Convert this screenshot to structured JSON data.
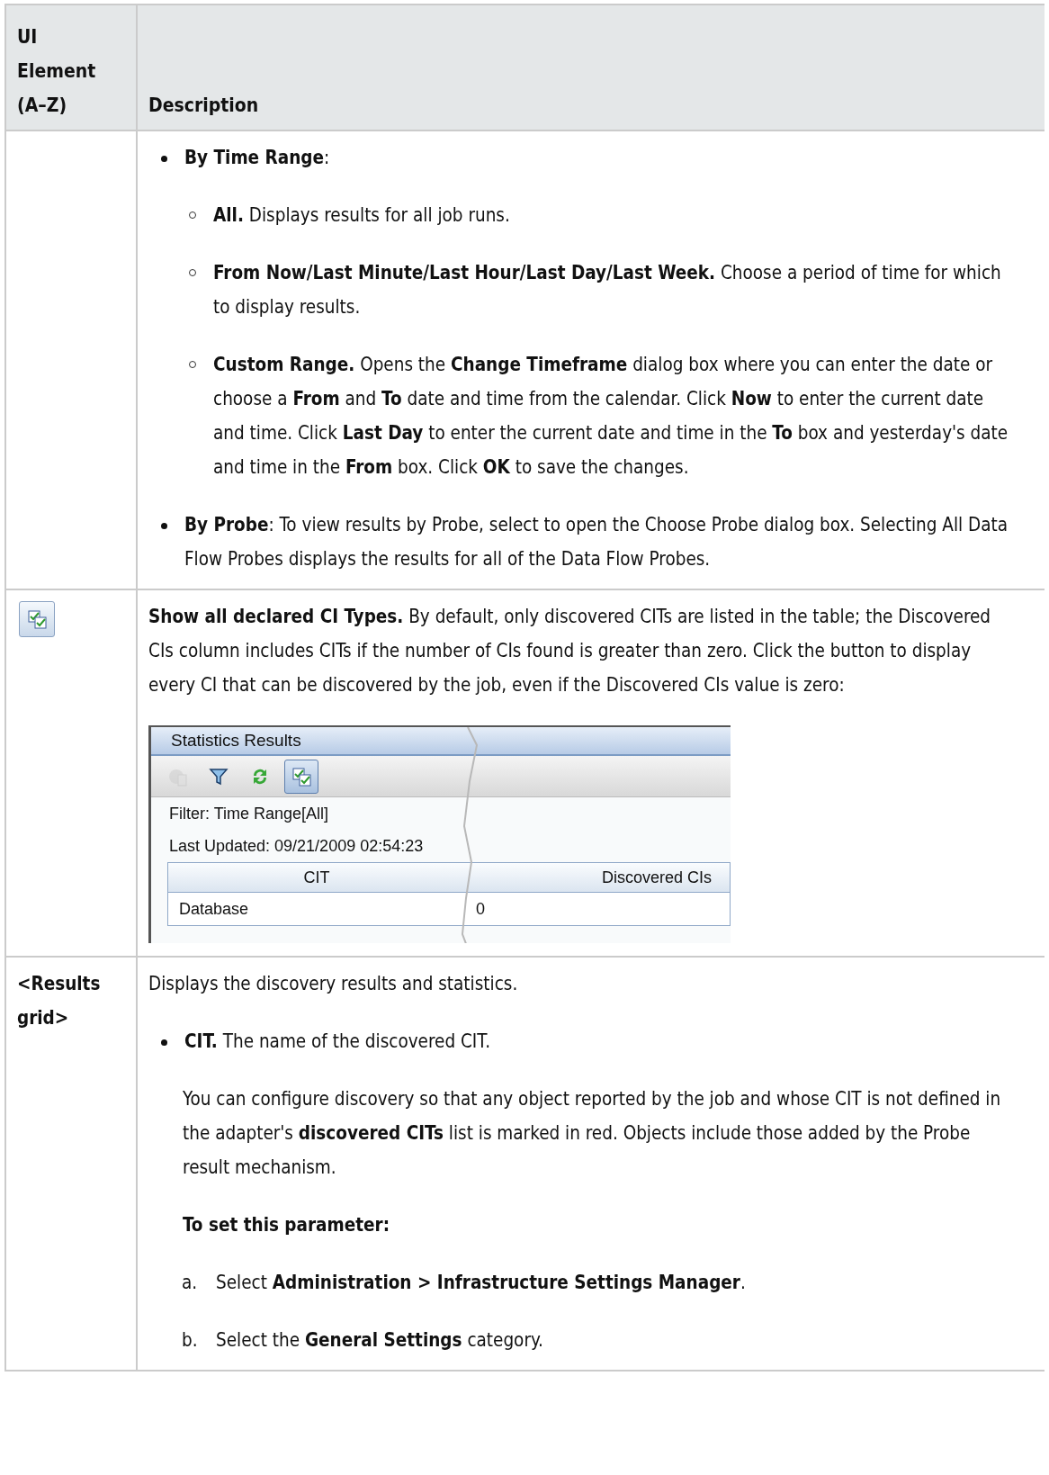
{
  "table": {
    "columns": [
      "UI Element (A–Z)",
      "Description"
    ],
    "rows": [
      {
        "element": {
          "kind": "none"
        },
        "blocks": [
          {
            "kind": "bullet",
            "text": "**By Time Range**:"
          },
          {
            "kind": "sub_bullet",
            "text": "**All.** Displays results for all job runs."
          },
          {
            "kind": "sub_bullet",
            "text": "**From Now/Last Minute/Last Hour/Last Day/Last Week.** Choose a period of time for which to display results."
          },
          {
            "kind": "sub_bullet",
            "text": "**Custom Range.** Opens the **Change Timeframe** dialog box where you can enter the date or choose a **From** and **To** date and time from the calendar. Click **Now** to enter the current date and time. Click **Last Day** to enter the current date and time in the **To** box and yesterday's date and time in the **From** box. Click **OK** to save the changes."
          },
          {
            "kind": "bullet",
            "text": "**By Probe**: To view results by Probe, select to open the Choose Probe dialog box. Selecting All Data Flow Probes displays the results for all of the Data Flow Probes."
          }
        ]
      },
      {
        "element": {
          "kind": "icon"
        },
        "blocks": [
          {
            "kind": "para",
            "text": "**Show all declared CI Types.** By default, only discovered CITs are listed in the table; the Discovered CIs column includes CITs if the number of CIs found is greater than zero. Click the button to display every CI that can be discovered by the job, even if the Discovered CIs value is zero:"
          },
          {
            "kind": "screenshot",
            "title": "Statistics Results",
            "toolbar": [
              {
                "kind": "chart",
                "disabled": true,
                "selected": false
              },
              {
                "kind": "filter",
                "disabled": false,
                "selected": false
              },
              {
                "kind": "refresh",
                "disabled": false,
                "selected": false
              },
              {
                "kind": "show_all",
                "disabled": false,
                "selected": true
              }
            ],
            "filter": "Filter: Time Range[All]",
            "updated": "Last Updated: 09/21/2009 02:54:23",
            "columns": [
              "CIT",
              "Discovered CIs"
            ],
            "rows": [
              [
                "Database",
                "0"
              ]
            ]
          }
        ]
      },
      {
        "element": {
          "kind": "text",
          "text": "<Results grid>"
        },
        "blocks": [
          {
            "kind": "para",
            "text": "Displays the discovery results and statistics."
          },
          {
            "kind": "bullet",
            "text": "**CIT.** The name of the discovered CIT."
          },
          {
            "kind": "indent",
            "text": "You can configure discovery so that any object reported by the job and whose CIT is not defined in the adapter's **discovered CITs** list is marked in red. Objects include those added by the Probe result mechanism."
          },
          {
            "kind": "indent_heading",
            "text": "To set this parameter:"
          },
          {
            "kind": "step",
            "marker": "a.",
            "text": "Select **Administration > Infrastructure Settings Manager**."
          },
          {
            "kind": "step",
            "marker": "b.",
            "text": "Select the **General Settings** category."
          }
        ]
      }
    ]
  }
}
